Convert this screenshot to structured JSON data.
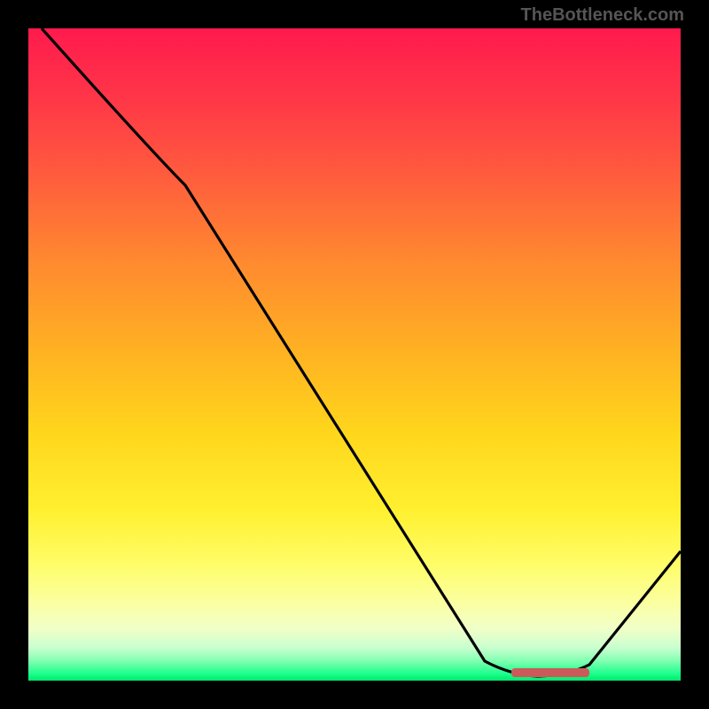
{
  "watermark": "TheBottleneck.com",
  "chart_data": {
    "type": "line",
    "title": "",
    "xlabel": "",
    "ylabel": "",
    "xlim": [
      0,
      100
    ],
    "ylim": [
      0,
      100
    ],
    "series": [
      {
        "name": "curve",
        "points": [
          {
            "x": 2,
            "y": 100
          },
          {
            "x": 24,
            "y": 76
          },
          {
            "x": 70,
            "y": 3
          },
          {
            "x": 78,
            "y": 1
          },
          {
            "x": 86,
            "y": 2
          },
          {
            "x": 100,
            "y": 20
          }
        ]
      }
    ],
    "marker": {
      "x_start": 74,
      "x_end": 86,
      "y": 1
    },
    "gradient_stops": [
      {
        "pos": 0,
        "color": "#ff1a4d"
      },
      {
        "pos": 50,
        "color": "#ffd61c"
      },
      {
        "pos": 88,
        "color": "#fbffa0"
      },
      {
        "pos": 100,
        "color": "#00e86a"
      }
    ]
  }
}
